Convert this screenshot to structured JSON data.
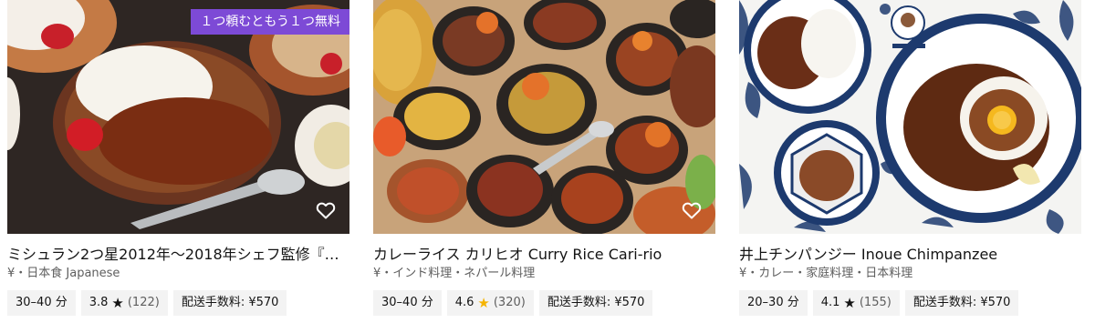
{
  "restaurants": [
    {
      "promo": "１つ頼むともう１つ無料",
      "title": "ミシュラン2つ星2012年～2018年シェフ監修『…",
      "subtitle": "¥・日本食 Japanese",
      "eta": "30–40 分",
      "rating": "3.8",
      "rating_count": "(122)",
      "fee": "配送手数料: ¥570",
      "star_color": "#141414",
      "favorite_icon": "heart-outline-icon"
    },
    {
      "promo": "",
      "title": "カレーライス カリヒオ Curry Rice Cari-rio",
      "subtitle": "¥・インド料理・ネパール料理",
      "eta": "30–40 分",
      "rating": "4.6",
      "rating_count": "(320)",
      "fee": "配送手数料: ¥570",
      "star_color": "#f5b400",
      "favorite_icon": "heart-outline-icon"
    },
    {
      "promo": "",
      "title": "井上チンパンジー Inoue Chimpanzee",
      "subtitle": "¥・カレー・家庭料理・日本料理",
      "eta": "20–30 分",
      "rating": "4.1",
      "rating_count": "(155)",
      "fee": "配送手数料: ¥570",
      "star_color": "#141414",
      "favorite_icon": "heart-outline-icon"
    }
  ],
  "colors": {
    "promo_bg": "#7d4ad6",
    "pill_bg": "#f3f3f3",
    "text_primary": "#141414",
    "text_secondary": "#5e5e5e"
  }
}
